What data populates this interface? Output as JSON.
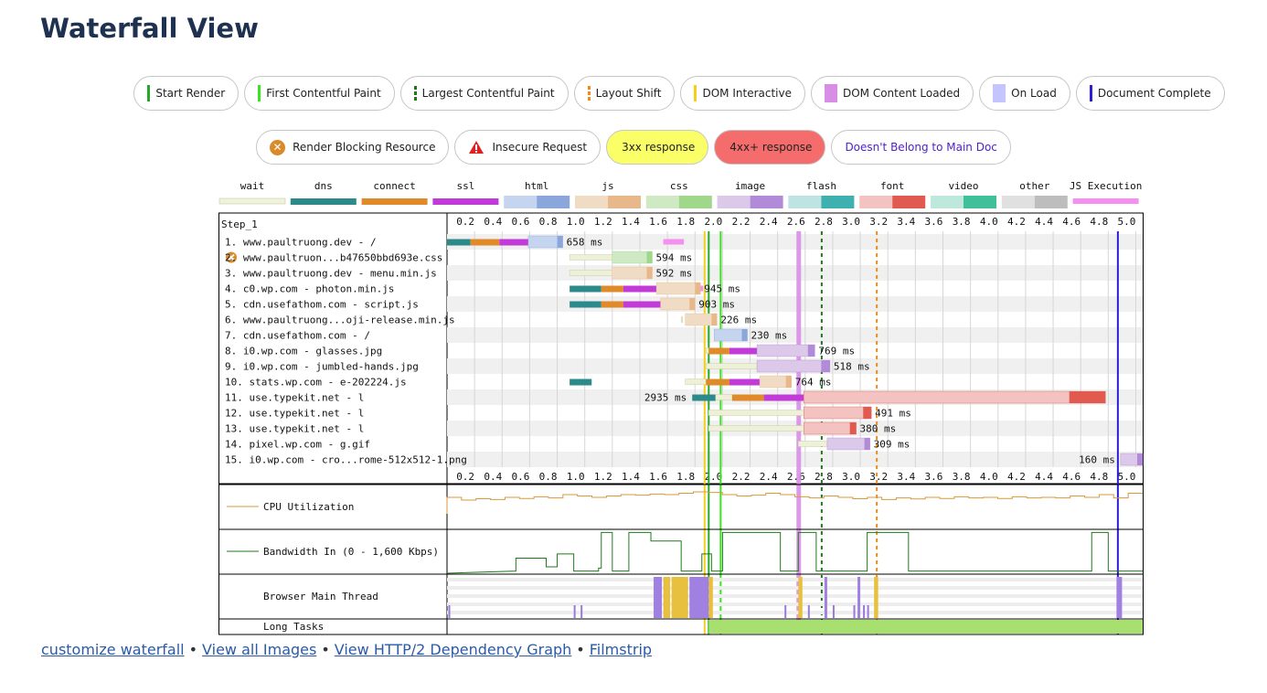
{
  "page": {
    "title": "Waterfall View"
  },
  "legend_markers": [
    {
      "label": "Start Render",
      "color": "#28a828",
      "style": "line"
    },
    {
      "label": "First Contentful Paint",
      "color": "#39e51f",
      "style": "line"
    },
    {
      "label": "Largest Contentful Paint",
      "color": "#1d7a19",
      "style": "dash"
    },
    {
      "label": "Layout Shift",
      "color": "#f28a18",
      "style": "dash"
    },
    {
      "label": "DOM Interactive",
      "color": "#f2d01b",
      "style": "line"
    },
    {
      "label": "DOM Content Loaded",
      "color": "#d88ee4",
      "style": "block"
    },
    {
      "label": "On Load",
      "color": "#c4c4ff",
      "style": "block"
    },
    {
      "label": "Document Complete",
      "color": "#2b1fd6",
      "style": "line"
    }
  ],
  "legend_status": [
    {
      "label": "Render Blocking Resource",
      "kind": "render-blocking"
    },
    {
      "label": "Insecure Request",
      "kind": "insecure"
    },
    {
      "label": "3xx response",
      "kind": "3xx"
    },
    {
      "label": "4xx+ response",
      "kind": "4xx"
    },
    {
      "label": "Doesn't Belong to Main Doc",
      "kind": "not-main"
    }
  ],
  "type_legend": [
    {
      "label": "wait",
      "colors": [
        "#f0f2dc",
        "#d6dcb0"
      ]
    },
    {
      "label": "dns",
      "colors": [
        "#2d8a8a",
        "#2d8a8a"
      ]
    },
    {
      "label": "connect",
      "colors": [
        "#e08a2a",
        "#e08a2a"
      ]
    },
    {
      "label": "ssl",
      "colors": [
        "#c23bd8",
        "#c23bd8"
      ]
    },
    {
      "label": "html",
      "colors": [
        "#c5d5ef",
        "#8aa6db"
      ]
    },
    {
      "label": "js",
      "colors": [
        "#f0dcc4",
        "#e8b88a"
      ]
    },
    {
      "label": "css",
      "colors": [
        "#cfe9c4",
        "#9fd88a"
      ]
    },
    {
      "label": "image",
      "colors": [
        "#dcc9ea",
        "#b18ad8"
      ]
    },
    {
      "label": "flash",
      "colors": [
        "#bfe3e3",
        "#3fb0b0"
      ]
    },
    {
      "label": "font",
      "colors": [
        "#f2c3c0",
        "#e05a50"
      ]
    },
    {
      "label": "video",
      "colors": [
        "#bfe8dc",
        "#3fbf9a"
      ]
    },
    {
      "label": "other",
      "colors": [
        "#e0e0e0",
        "#bdbdbd"
      ]
    },
    {
      "label": "JS Execution",
      "colors": [
        "#f58ff0",
        "#f58ff0"
      ]
    }
  ],
  "waterfall": {
    "step_label": "Step_1",
    "ticks": [
      "0.2",
      "0.4",
      "0.6",
      "0.8",
      "1.0",
      "1.2",
      "1.4",
      "1.6",
      "1.8",
      "2.0",
      "2.2",
      "2.4",
      "2.6",
      "2.8",
      "3.0",
      "3.2",
      "3.4",
      "3.6",
      "3.8",
      "4.0",
      "4.2",
      "4.4",
      "4.6",
      "4.8",
      "5.0"
    ],
    "max_seconds": 5.05,
    "markers": {
      "start_render": 1.9,
      "first_contentful_paint": 1.92,
      "dom_interactive": 1.87,
      "largest_contentful_paint": 2.72,
      "layout_shift": 3.12,
      "dom_content_loaded": 2.55,
      "on_load": 2.57,
      "document_complete": 4.87
    },
    "requests": [
      {
        "label": "1. www.paultruong.dev - /",
        "type": "html",
        "time": "658 ms",
        "blocking": false,
        "segs": [
          [
            0,
            0.17,
            "dns"
          ],
          [
            0.17,
            0.38,
            "connect"
          ],
          [
            0.38,
            0.59,
            "ssl"
          ],
          [
            0.59,
            0.84,
            "html"
          ]
        ],
        "js": [
          [
            1.57,
            1.72
          ]
        ]
      },
      {
        "label": "2. www.paultruon...b47650bbd693e.css",
        "type": "css",
        "time": "594 ms",
        "blocking": true,
        "segs": [
          [
            0.89,
            1.2,
            "wait"
          ],
          [
            1.2,
            1.49,
            "css"
          ]
        ],
        "js": []
      },
      {
        "label": "3. www.paultruong.dev - menu.min.js",
        "type": "js",
        "time": "592 ms",
        "blocking": false,
        "segs": [
          [
            0.89,
            1.2,
            "wait"
          ],
          [
            1.2,
            1.49,
            "js"
          ]
        ],
        "js": []
      },
      {
        "label": "4. c0.wp.com - photon.min.js",
        "type": "js",
        "time": "945 ms",
        "blocking": false,
        "segs": [
          [
            0.89,
            1.12,
            "dns"
          ],
          [
            1.12,
            1.28,
            "connect"
          ],
          [
            1.28,
            1.52,
            "ssl"
          ],
          [
            1.52,
            1.84,
            "js"
          ]
        ],
        "js": [
          [
            1.84,
            1.86
          ]
        ]
      },
      {
        "label": "5. cdn.usefathom.com - script.js",
        "type": "js",
        "time": "903 ms",
        "blocking": false,
        "segs": [
          [
            0.89,
            1.12,
            "dns"
          ],
          [
            1.12,
            1.28,
            "connect"
          ],
          [
            1.28,
            1.55,
            "ssl"
          ],
          [
            1.55,
            1.8,
            "js"
          ]
        ],
        "js": []
      },
      {
        "label": "6. www.paultruong...oji-release.min.js",
        "type": "js",
        "time": "226 ms",
        "blocking": false,
        "segs": [
          [
            1.7,
            1.71,
            "wait"
          ],
          [
            1.73,
            1.96,
            "js"
          ]
        ],
        "js": []
      },
      {
        "label": "7. cdn.usefathom.com - /",
        "type": "other",
        "time": "230 ms",
        "blocking": false,
        "segs": [
          [
            1.94,
            2.18,
            "html"
          ]
        ],
        "js": []
      },
      {
        "label": "8. i0.wp.com - glasses.jpg",
        "type": "image",
        "time": "769 ms",
        "blocking": false,
        "segs": [
          [
            1.88,
            1.9,
            "wait"
          ],
          [
            1.9,
            2.05,
            "connect"
          ],
          [
            2.05,
            2.25,
            "ssl"
          ],
          [
            2.25,
            2.67,
            "image"
          ]
        ],
        "js": []
      },
      {
        "label": "9. i0.wp.com - jumbled-hands.jpg",
        "type": "image",
        "time": "518 ms",
        "blocking": false,
        "segs": [
          [
            1.88,
            2.25,
            "wait"
          ],
          [
            2.25,
            2.78,
            "image"
          ]
        ],
        "js": []
      },
      {
        "label": "10. stats.wp.com - e-202224.js",
        "type": "js",
        "time": "764 ms",
        "blocking": false,
        "segs": [
          [
            0.89,
            1.05,
            "dns"
          ],
          [
            1.73,
            1.88,
            "wait"
          ],
          [
            1.88,
            2.05,
            "connect"
          ],
          [
            2.05,
            2.27,
            "ssl"
          ],
          [
            2.27,
            2.5,
            "js"
          ]
        ],
        "js": []
      },
      {
        "label": "11. use.typekit.net - l",
        "type": "font",
        "time": "2935 ms",
        "blocking": false,
        "segs": [
          [
            1.78,
            1.95,
            "dns"
          ],
          [
            1.95,
            2.07,
            "wait"
          ],
          [
            2.07,
            2.3,
            "connect"
          ],
          [
            2.3,
            2.59,
            "ssl"
          ],
          [
            2.59,
            4.78,
            "font"
          ]
        ],
        "js": [],
        "time_left": true
      },
      {
        "label": "12. use.typekit.net - l",
        "type": "font",
        "time": "491 ms",
        "blocking": false,
        "segs": [
          [
            1.9,
            2.59,
            "wait"
          ],
          [
            2.59,
            3.08,
            "font"
          ]
        ],
        "js": []
      },
      {
        "label": "13. use.typekit.net - l",
        "type": "font",
        "time": "380 ms",
        "blocking": false,
        "segs": [
          [
            1.9,
            2.59,
            "wait"
          ],
          [
            2.59,
            2.97,
            "font"
          ]
        ],
        "js": []
      },
      {
        "label": "14. pixel.wp.com - g.gif",
        "type": "image",
        "time": "309 ms",
        "blocking": false,
        "segs": [
          [
            2.55,
            2.76,
            "wait"
          ],
          [
            2.76,
            3.07,
            "image"
          ]
        ],
        "js": []
      },
      {
        "label": "15. i0.wp.com - cro...rome-512x512-1.png",
        "type": "image",
        "time": "160 ms",
        "blocking": false,
        "segs": [
          [
            4.89,
            5.05,
            "image"
          ]
        ],
        "js": [],
        "time_left": true
      }
    ],
    "graphs": {
      "cpu": "CPU Utilization",
      "bandwidth": "Bandwidth In (0 - 1,600 Kbps)",
      "main_thread": "Browser Main Thread",
      "long_tasks": "Long Tasks"
    }
  },
  "footer": {
    "links": [
      "customize waterfall",
      "View all Images",
      "View HTTP/2 Dependency Graph",
      "Filmstrip"
    ],
    "separator": "•"
  }
}
